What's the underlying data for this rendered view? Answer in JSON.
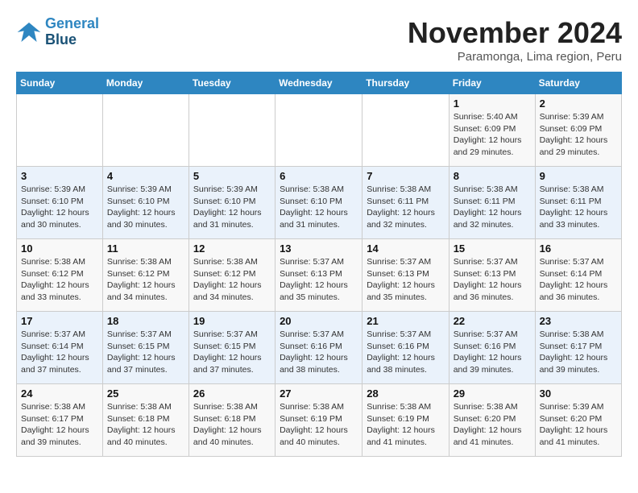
{
  "logo": {
    "line1": "General",
    "line2": "Blue"
  },
  "title": "November 2024",
  "location": "Paramonga, Lima region, Peru",
  "weekdays": [
    "Sunday",
    "Monday",
    "Tuesday",
    "Wednesday",
    "Thursday",
    "Friday",
    "Saturday"
  ],
  "weeks": [
    [
      {
        "day": "",
        "info": ""
      },
      {
        "day": "",
        "info": ""
      },
      {
        "day": "",
        "info": ""
      },
      {
        "day": "",
        "info": ""
      },
      {
        "day": "",
        "info": ""
      },
      {
        "day": "1",
        "info": "Sunrise: 5:40 AM\nSunset: 6:09 PM\nDaylight: 12 hours and 29 minutes."
      },
      {
        "day": "2",
        "info": "Sunrise: 5:39 AM\nSunset: 6:09 PM\nDaylight: 12 hours and 29 minutes."
      }
    ],
    [
      {
        "day": "3",
        "info": "Sunrise: 5:39 AM\nSunset: 6:10 PM\nDaylight: 12 hours and 30 minutes."
      },
      {
        "day": "4",
        "info": "Sunrise: 5:39 AM\nSunset: 6:10 PM\nDaylight: 12 hours and 30 minutes."
      },
      {
        "day": "5",
        "info": "Sunrise: 5:39 AM\nSunset: 6:10 PM\nDaylight: 12 hours and 31 minutes."
      },
      {
        "day": "6",
        "info": "Sunrise: 5:38 AM\nSunset: 6:10 PM\nDaylight: 12 hours and 31 minutes."
      },
      {
        "day": "7",
        "info": "Sunrise: 5:38 AM\nSunset: 6:11 PM\nDaylight: 12 hours and 32 minutes."
      },
      {
        "day": "8",
        "info": "Sunrise: 5:38 AM\nSunset: 6:11 PM\nDaylight: 12 hours and 32 minutes."
      },
      {
        "day": "9",
        "info": "Sunrise: 5:38 AM\nSunset: 6:11 PM\nDaylight: 12 hours and 33 minutes."
      }
    ],
    [
      {
        "day": "10",
        "info": "Sunrise: 5:38 AM\nSunset: 6:12 PM\nDaylight: 12 hours and 33 minutes."
      },
      {
        "day": "11",
        "info": "Sunrise: 5:38 AM\nSunset: 6:12 PM\nDaylight: 12 hours and 34 minutes."
      },
      {
        "day": "12",
        "info": "Sunrise: 5:38 AM\nSunset: 6:12 PM\nDaylight: 12 hours and 34 minutes."
      },
      {
        "day": "13",
        "info": "Sunrise: 5:37 AM\nSunset: 6:13 PM\nDaylight: 12 hours and 35 minutes."
      },
      {
        "day": "14",
        "info": "Sunrise: 5:37 AM\nSunset: 6:13 PM\nDaylight: 12 hours and 35 minutes."
      },
      {
        "day": "15",
        "info": "Sunrise: 5:37 AM\nSunset: 6:13 PM\nDaylight: 12 hours and 36 minutes."
      },
      {
        "day": "16",
        "info": "Sunrise: 5:37 AM\nSunset: 6:14 PM\nDaylight: 12 hours and 36 minutes."
      }
    ],
    [
      {
        "day": "17",
        "info": "Sunrise: 5:37 AM\nSunset: 6:14 PM\nDaylight: 12 hours and 37 minutes."
      },
      {
        "day": "18",
        "info": "Sunrise: 5:37 AM\nSunset: 6:15 PM\nDaylight: 12 hours and 37 minutes."
      },
      {
        "day": "19",
        "info": "Sunrise: 5:37 AM\nSunset: 6:15 PM\nDaylight: 12 hours and 37 minutes."
      },
      {
        "day": "20",
        "info": "Sunrise: 5:37 AM\nSunset: 6:16 PM\nDaylight: 12 hours and 38 minutes."
      },
      {
        "day": "21",
        "info": "Sunrise: 5:37 AM\nSunset: 6:16 PM\nDaylight: 12 hours and 38 minutes."
      },
      {
        "day": "22",
        "info": "Sunrise: 5:37 AM\nSunset: 6:16 PM\nDaylight: 12 hours and 39 minutes."
      },
      {
        "day": "23",
        "info": "Sunrise: 5:38 AM\nSunset: 6:17 PM\nDaylight: 12 hours and 39 minutes."
      }
    ],
    [
      {
        "day": "24",
        "info": "Sunrise: 5:38 AM\nSunset: 6:17 PM\nDaylight: 12 hours and 39 minutes."
      },
      {
        "day": "25",
        "info": "Sunrise: 5:38 AM\nSunset: 6:18 PM\nDaylight: 12 hours and 40 minutes."
      },
      {
        "day": "26",
        "info": "Sunrise: 5:38 AM\nSunset: 6:18 PM\nDaylight: 12 hours and 40 minutes."
      },
      {
        "day": "27",
        "info": "Sunrise: 5:38 AM\nSunset: 6:19 PM\nDaylight: 12 hours and 40 minutes."
      },
      {
        "day": "28",
        "info": "Sunrise: 5:38 AM\nSunset: 6:19 PM\nDaylight: 12 hours and 41 minutes."
      },
      {
        "day": "29",
        "info": "Sunrise: 5:38 AM\nSunset: 6:20 PM\nDaylight: 12 hours and 41 minutes."
      },
      {
        "day": "30",
        "info": "Sunrise: 5:39 AM\nSunset: 6:20 PM\nDaylight: 12 hours and 41 minutes."
      }
    ]
  ]
}
